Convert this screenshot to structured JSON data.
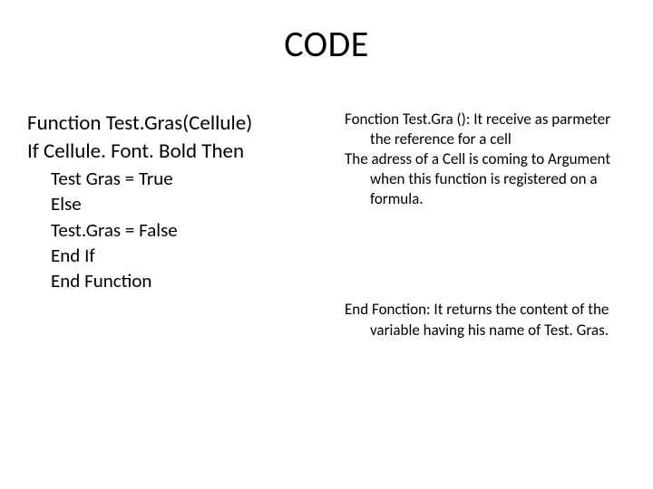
{
  "title": "CODE",
  "left": {
    "line1": "Function Test.Gras(Cellule)",
    "line2": "If Cellule. Font. Bold Then",
    "line3": "Test Gras = True",
    "line4": "Else",
    "line5": "Test.Gras = False",
    "line6": "End If",
    "line7": "End Function"
  },
  "right": {
    "p1a": "Fonction Test.Gra  (): It receive  as parmeter  the reference for a cell",
    "p1b": "The adress of a Cell is coming to Argument when this function is registered on a formula.",
    "p2": "End Fonction: It returns the content of  the variable having his name of Test. Gras."
  }
}
